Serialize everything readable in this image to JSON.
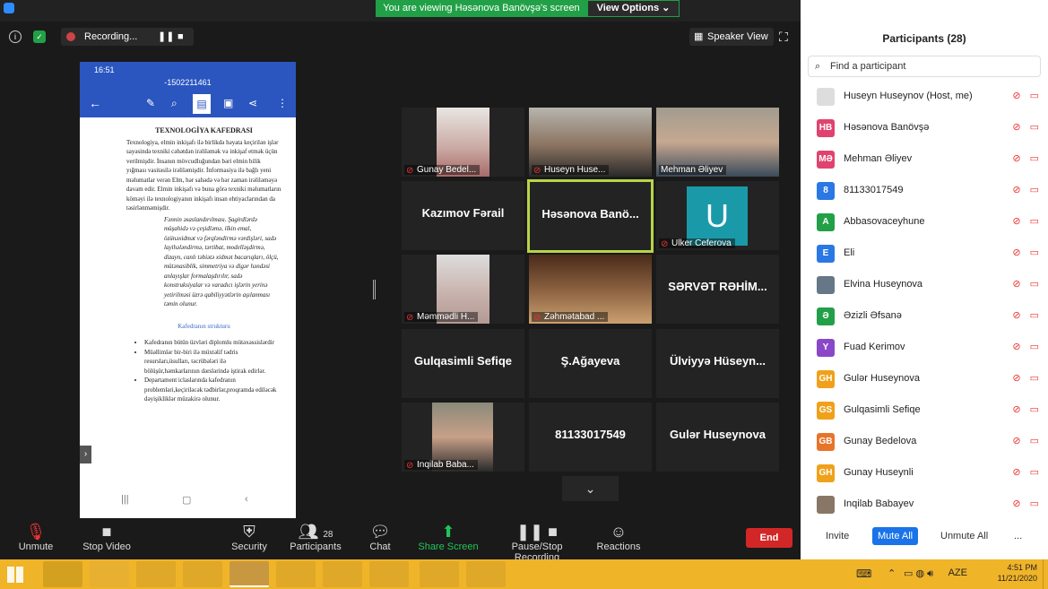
{
  "banner": {
    "viewing": "You are viewing Həsənova Banövşə's screen",
    "view_options": "View Options"
  },
  "topbar": {
    "recording": "Recording...",
    "speaker_view": "Speaker View"
  },
  "phone": {
    "time": "16:51",
    "number": "-1502211461"
  },
  "doc": {
    "title": "TEXNOLOGİYA KAFEDRASI",
    "para1": "Texnologiya, elmin inkişafı ilə birlikdə həyata keçirilən işlər sayəsində texniki cəhətdən irəliləmək və inkişaf etmək üçün verilmişdir. İnsanın mövcudluğundan bəri elmin bilik yığması vasitəsilə irəliləmişdir. İnformasiya ilə bağlı yeni məlumatlar verən Elm, hər sahədə və hər zaman irəliləməyə davam edir. Elmin inkişafı və buna görə texniki məlumatların köməyi ilə texnologiyanın inkişafı insan ehtiyaclarından da təsirlənməmişdir.",
    "para2": "Fənnin əsaslandırılması. Şagirdlərdə müşahidə və çeşidləmə, ilkin emal, özünəxidmət və fərqləndirmə vərdişləri, sadə layihələndirmə, tərtibat, modelləşdirmə, dizayn, canlı təbiətə xidmət bacarıqları, ölçü, mütənasiblik, simmetriya və digər həndəsi anlayışlar formalaşdırılır, sadə konstruksiyalar və varadıcı işlərin yerinə yetirilməsi üzrə qabiliyyətlərin aşılanması təmin olunur.",
    "subtitle": "Kafedranın strukturu",
    "bullets": [
      "Kafedranın bütün üzvləri diplomlu mütəxəssislərdir",
      "Müəllimlər bir-biri ilə müxtəlif tədris resursları,üsulları, təcrübələri ilə bölüşür,həmkarlarının dərslərində iştirak edirlər.",
      "Departament iclaslarında kafedranın problemləri,keçiriləcək tədbirlər,proqramda ediləcək dəyişikliklər müzakirə olunur."
    ]
  },
  "tiles": [
    {
      "label": "Gunay Bedel...",
      "muted": true,
      "photo": true
    },
    {
      "label": "Huseyn Huse...",
      "muted": true,
      "photo": true
    },
    {
      "label": "Mehman Əliyev",
      "muted": false,
      "photo": true
    },
    {
      "label": "",
      "big": "Kazımov Fərail",
      "muted": true
    },
    {
      "label": "",
      "big": "Həsənova Banö...",
      "muted": false,
      "active": true
    },
    {
      "label": "Ulker Ceferova",
      "muted": true,
      "avatar": "U"
    },
    {
      "label": "Məmmədli H...",
      "muted": true,
      "photo": true
    },
    {
      "label": "Zəhmətabad ...",
      "muted": true,
      "photo": true
    },
    {
      "label": "",
      "big": "SƏRVƏT RƏHİM...",
      "muted": true
    },
    {
      "label": "",
      "big": "Gulqasimli Sefiqe",
      "muted": true
    },
    {
      "label": "",
      "big": "Ş.Ağayeva",
      "muted": true
    },
    {
      "label": "",
      "big": "Ülviyyə Hüseyn...",
      "muted": true
    },
    {
      "label": "Inqilab Baba...",
      "muted": true,
      "photo": true
    },
    {
      "label": "",
      "big": "81133017549",
      "muted": true
    },
    {
      "label": "",
      "big": "Gulər Huseynova",
      "muted": true
    }
  ],
  "participants": {
    "title": "Participants (28)",
    "search_placeholder": "Find a participant",
    "list": [
      {
        "initials": "",
        "name": "Huseyn Huseynov (Host, me)",
        "color": "#dddddd"
      },
      {
        "initials": "HB",
        "name": "Həsənova Banövşə",
        "color": "#e0436e"
      },
      {
        "initials": "MƏ",
        "name": "Mehman Əliyev",
        "color": "#e0436e"
      },
      {
        "initials": "8",
        "name": "81133017549",
        "color": "#2a78e4"
      },
      {
        "initials": "A",
        "name": "Abbasovaceyhune",
        "color": "#22a047"
      },
      {
        "initials": "E",
        "name": "Eli",
        "color": "#2a78e4"
      },
      {
        "initials": "",
        "name": "Elvina Huseynova",
        "color": "#667788"
      },
      {
        "initials": "Ə",
        "name": "Əzizli Əfsanə",
        "color": "#22a047"
      },
      {
        "initials": "Y",
        "name": "Fuad Kerimov",
        "color": "#8a47c8"
      },
      {
        "initials": "GH",
        "name": "Gulər Huseynova",
        "color": "#f0a11a"
      },
      {
        "initials": "GS",
        "name": "Gulqasimli Sefiqe",
        "color": "#f0a11a"
      },
      {
        "initials": "GB",
        "name": "Gunay Bedelova",
        "color": "#e8742a"
      },
      {
        "initials": "GH",
        "name": "Gunay Huseynli",
        "color": "#f0a11a"
      },
      {
        "initials": "",
        "name": "Inqilab Babayev",
        "color": "#887766"
      }
    ],
    "invite": "Invite",
    "mute_all": "Mute All",
    "unmute_all": "Unmute All",
    "more": "..."
  },
  "bottom": {
    "unmute": "Unmute",
    "stop_video": "Stop Video",
    "security": "Security",
    "participants": "Participants",
    "participants_count": "28",
    "chat": "Chat",
    "share_screen": "Share Screen",
    "pause_stop": "Pause/Stop Recording",
    "reactions": "Reactions",
    "end": "End"
  },
  "taskbar": {
    "lang": "AZE",
    "time": "4:51 PM",
    "date": "11/21/2020"
  }
}
